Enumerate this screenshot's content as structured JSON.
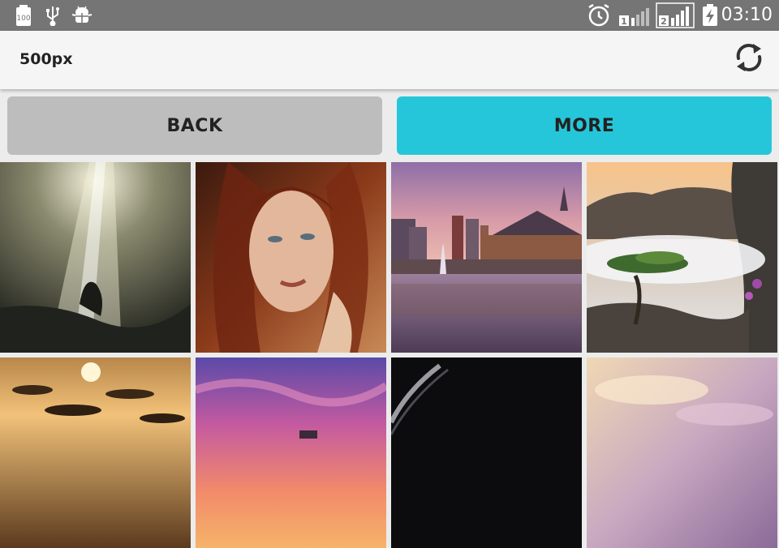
{
  "status_bar": {
    "battery_label": "100",
    "time": "03:10",
    "sim1_label": "1",
    "sim2_label": "2",
    "icons": [
      "battery-100-icon",
      "usb-icon",
      "android-debug-icon",
      "alarm-icon",
      "signal-sim1-icon",
      "signal-sim2-icon",
      "battery-charging-icon"
    ]
  },
  "app_bar": {
    "title": "500px",
    "refresh_icon": "refresh-icon"
  },
  "buttons": {
    "back_label": "BACK",
    "more_label": "MORE"
  },
  "colors": {
    "status_bar": "#757575",
    "app_bar": "#f5f5f5",
    "back_button": "#bdbdbd",
    "more_button": "#26c6da",
    "background": "#ececec"
  },
  "photos": [
    {
      "subject": "light beams in cave with figure"
    },
    {
      "subject": "red-haired woman portrait"
    },
    {
      "subject": "city buildings with fountain reflection at sunset"
    },
    {
      "subject": "tree on cliff above clouds"
    },
    {
      "subject": "golden sunset over rocky shore"
    },
    {
      "subject": "pink purple sunset sky"
    },
    {
      "subject": "dark night sky"
    },
    {
      "subject": "pastel clouds sky"
    }
  ]
}
